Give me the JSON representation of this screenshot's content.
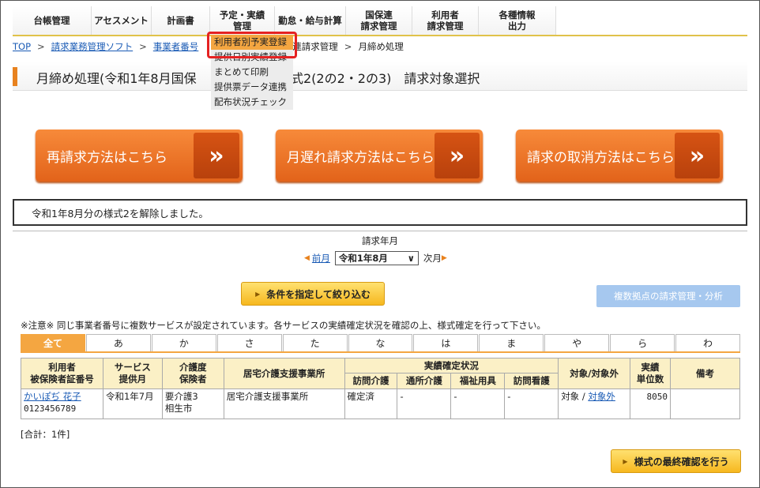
{
  "nav": {
    "items": [
      {
        "label": "台帳管理"
      },
      {
        "label": "アセスメント"
      },
      {
        "label": "計画書"
      },
      {
        "label": "予定・実績\n管理"
      },
      {
        "label": "勤怠・給与計算"
      },
      {
        "label": "国保連\n請求管理"
      },
      {
        "label": "利用者\n請求管理"
      },
      {
        "label": "各種情報\n出力"
      }
    ]
  },
  "breadcrumb": {
    "top": "TOP",
    "software": "請求業務管理ソフト",
    "office": "事業者番号",
    "kokuho": "国保連請求管理",
    "current": "月締め処理",
    "sep": ">"
  },
  "dropdown": {
    "items": [
      {
        "label": "利用者別予実登録"
      },
      {
        "label": "提供日別実績登録"
      },
      {
        "label": "まとめて印刷"
      },
      {
        "label": "提供票データ連携"
      },
      {
        "label": "配布状況チェック"
      }
    ]
  },
  "page_title": {
    "part1": "月締め処理(令和1年8月国保",
    "part2": "式2(2の2・2の3)　請求対象選択"
  },
  "big_buttons": [
    {
      "label": "再請求方法はこちら",
      "arrow": "»"
    },
    {
      "label": "月遅れ請求方法はこちら",
      "arrow": "»"
    },
    {
      "label": "請求の取消方法はこちら",
      "arrow": "»"
    }
  ],
  "message": "令和1年8月分の様式2を解除しました。",
  "month_selector": {
    "label": "請求年月",
    "prev": "前月",
    "selected": "令和1年8月",
    "next": "次月",
    "caret": "∨"
  },
  "filter_button": "条件を指定して絞り込む",
  "multi_site_button": "複数拠点の請求管理・分析",
  "notice": "※注意※ 同じ事業者番号に複数サービスが設定されています。各サービスの実績確定状況を確認の上、様式確定を行って下さい。",
  "kana_tabs": [
    "全て",
    "あ",
    "か",
    "さ",
    "た",
    "な",
    "は",
    "ま",
    "や",
    "ら",
    "わ"
  ],
  "table": {
    "headers": {
      "user": "利用者\n被保険者証番号",
      "service_month": "サービス\n提供月",
      "care_level": "介護度\n保険者",
      "care_office": "居宅介護支援事業所",
      "status_group": "実績確定状況",
      "status_cols": [
        "訪問介護",
        "通所介護",
        "福祉用具",
        "訪問看護"
      ],
      "target": "対象/対象外",
      "units": "実績\n単位数",
      "remarks": "備考"
    },
    "rows": [
      {
        "user_name": "かいぽぢ 花子",
        "insured_no": "0123456789",
        "service_month": "令和1年7月",
        "care_level": "要介護3",
        "insurer": "相生市",
        "care_office": "居宅介護支援事業所",
        "statuses": [
          "確定済",
          "-",
          "-",
          "-"
        ],
        "target": "対象",
        "target_sep": " / ",
        "non_target": "対象外",
        "units": "8050",
        "remarks": ""
      }
    ]
  },
  "total": "[合計：1件]",
  "confirm_button": "様式の最終確認を行う",
  "colors": {
    "accent": "#e8821e",
    "highlight": "#e52222",
    "link": "#1a5bb5"
  }
}
